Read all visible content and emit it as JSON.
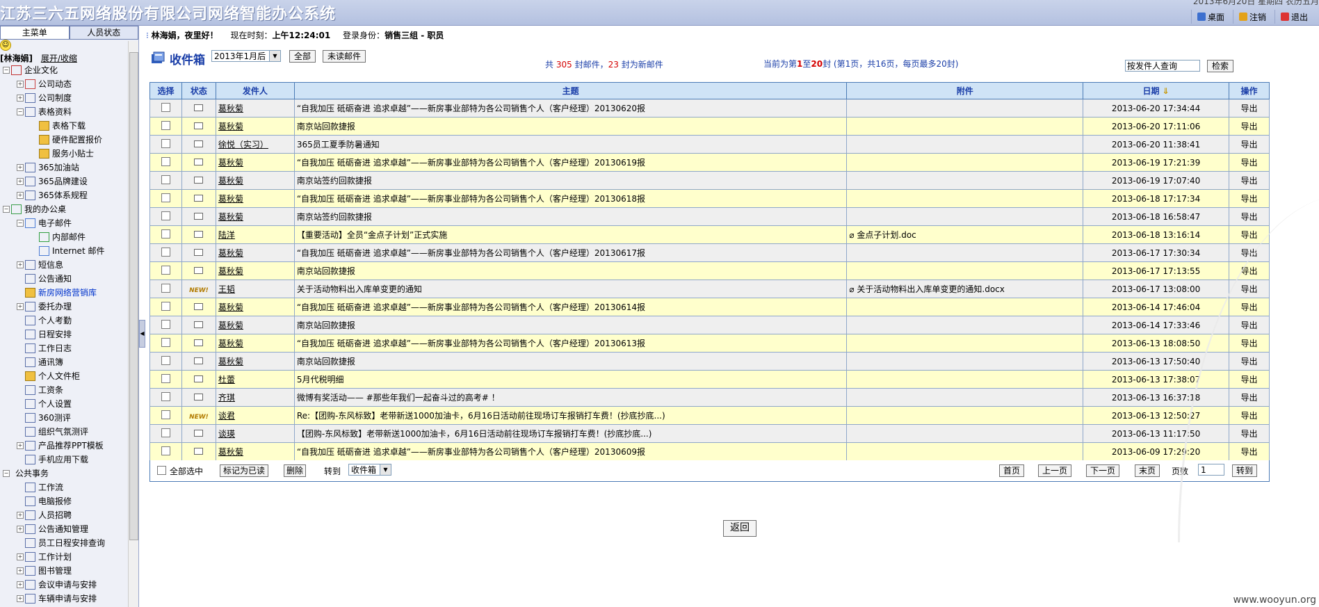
{
  "app": {
    "title": "江苏三六五网络股份有限公司网络智能办公系统",
    "date_partial": "2013年6月20日 星期四 农历五月",
    "buttons": {
      "desktop": "桌面",
      "logout": "注销",
      "exit": "退出"
    }
  },
  "left": {
    "tabs": {
      "main_menu": "主菜单",
      "people": "人员状态"
    },
    "user": "[林海娟]",
    "toggle": "展开/收缩",
    "tree": [
      {
        "label": "企业文化",
        "level": 0,
        "exp": "-",
        "icon": "culture-icon"
      },
      {
        "label": "公司动态",
        "level": 1,
        "exp": "+",
        "icon": "chart-icon"
      },
      {
        "label": "公司制度",
        "level": 1,
        "exp": "+",
        "icon": "document-icon"
      },
      {
        "label": "表格资料",
        "level": 1,
        "exp": "-",
        "icon": "search-doc-icon"
      },
      {
        "label": "表格下载",
        "level": 2,
        "exp": "",
        "icon": "folder-icon"
      },
      {
        "label": "硬件配置报价",
        "level": 2,
        "exp": "",
        "icon": "folder-icon"
      },
      {
        "label": "服务小贴士",
        "level": 2,
        "exp": "",
        "icon": "folder-icon"
      },
      {
        "label": "365加油站",
        "level": 1,
        "exp": "+",
        "icon": "station-icon"
      },
      {
        "label": "365品牌建设",
        "level": 1,
        "exp": "+",
        "icon": "window-icon"
      },
      {
        "label": "365体系规程",
        "level": 1,
        "exp": "+",
        "icon": "window-icon"
      },
      {
        "label": "我的办公桌",
        "level": 0,
        "exp": "-",
        "icon": "desk-icon"
      },
      {
        "label": "电子邮件",
        "level": 1,
        "exp": "-",
        "icon": "mail-icon"
      },
      {
        "label": "内部邮件",
        "level": 2,
        "exp": "",
        "icon": "inner-mail-icon"
      },
      {
        "label": "Internet 邮件",
        "level": 2,
        "exp": "",
        "icon": "internet-mail-icon"
      },
      {
        "label": "短信息",
        "level": 1,
        "exp": "+",
        "icon": "sms-icon"
      },
      {
        "label": "公告通知",
        "level": 1,
        "exp": "",
        "icon": "announce-icon"
      },
      {
        "label": "新房网络营销库",
        "level": 1,
        "exp": "",
        "icon": "folder-icon",
        "highlight": true
      },
      {
        "label": "委托办理",
        "level": 1,
        "exp": "+",
        "icon": "delegate-icon"
      },
      {
        "label": "个人考勤",
        "level": 1,
        "exp": "",
        "icon": "attendance-icon"
      },
      {
        "label": "日程安排",
        "level": 1,
        "exp": "",
        "icon": "calendar-icon"
      },
      {
        "label": "工作日志",
        "level": 1,
        "exp": "",
        "icon": "pencil-icon"
      },
      {
        "label": "通讯簿",
        "level": 1,
        "exp": "",
        "icon": "addressbook-icon"
      },
      {
        "label": "个人文件柜",
        "level": 1,
        "exp": "",
        "icon": "folder-icon"
      },
      {
        "label": "工资条",
        "level": 1,
        "exp": "",
        "icon": "salary-icon"
      },
      {
        "label": "个人设置",
        "level": 1,
        "exp": "",
        "icon": "settings-icon"
      },
      {
        "label": "360测评",
        "level": 1,
        "exp": "",
        "icon": "evaluation-icon"
      },
      {
        "label": "组织气氛测评",
        "level": 1,
        "exp": "",
        "icon": "evaluation-icon"
      },
      {
        "label": "产品推荐PPT模板",
        "level": 1,
        "exp": "+",
        "icon": "document-icon"
      },
      {
        "label": "手机应用下载",
        "level": 1,
        "exp": "",
        "icon": "download-icon"
      },
      {
        "label": "公共事务",
        "level": 0,
        "exp": "-",
        "icon": ""
      },
      {
        "label": "工作流",
        "level": 1,
        "exp": "",
        "icon": "workflow-icon"
      },
      {
        "label": "电脑报修",
        "level": 1,
        "exp": "",
        "icon": "repair-icon"
      },
      {
        "label": "人员招聘",
        "level": 1,
        "exp": "+",
        "icon": "recruit-icon"
      },
      {
        "label": "公告通知管理",
        "level": 1,
        "exp": "+",
        "icon": "announce-icon"
      },
      {
        "label": "员工日程安排查询",
        "level": 1,
        "exp": "",
        "icon": "document-icon"
      },
      {
        "label": "工作计划",
        "level": 1,
        "exp": "+",
        "icon": "plan-icon"
      },
      {
        "label": "图书管理",
        "level": 1,
        "exp": "+",
        "icon": "book-icon"
      },
      {
        "label": "会议申请与安排",
        "level": 1,
        "exp": "+",
        "icon": "meeting-icon"
      },
      {
        "label": "车辆申请与安排",
        "level": 1,
        "exp": "+",
        "icon": "car-icon"
      }
    ]
  },
  "status": {
    "greeting": "林海娟，夜里好！",
    "time_label": "现在时刻：",
    "time": "上午12:24:01",
    "role_label": "登录身份：",
    "role": "销售三组 - 职员"
  },
  "inbox": {
    "title": "收件箱",
    "period": "2013年1月后",
    "btn_all": "全部",
    "btn_unread": "未读邮件",
    "count_prefix": "共",
    "count_total": "305",
    "count_mid": "封邮件，",
    "count_new": "23",
    "count_suffix": "封为新邮件",
    "page_info_prefix": "当前为第",
    "page_from": "1",
    "page_to_label": "至",
    "page_to": "20",
    "page_info_suffix": "封 (第1页，共16页，每页最多20封)",
    "search_placeholder": "按发件人查询",
    "search_button": "检索"
  },
  "table": {
    "headers": [
      "选择",
      "状态",
      "发件人",
      "主题",
      "附件",
      "日期",
      "操作"
    ],
    "export_label": "导出",
    "rows": [
      {
        "status": "read",
        "sender": "葛秋菊",
        "subject": "“自我加压 砥砺奋进 追求卓越”——新房事业部特为各公司销售个人（客户经理）20130620报",
        "attachment": "",
        "date": "2013-06-20 17:34:44"
      },
      {
        "status": "read",
        "sender": "葛秋菊",
        "subject": "南京站回款捷报",
        "attachment": "",
        "date": "2013-06-20 17:11:06"
      },
      {
        "status": "read",
        "sender": "徐悦（实习）",
        "subject": "365员工夏季防暑通知",
        "attachment": "",
        "date": "2013-06-20 11:38:41"
      },
      {
        "status": "read",
        "sender": "葛秋菊",
        "subject": "“自我加压 砥砺奋进 追求卓越”——新房事业部特为各公司销售个人（客户经理）20130619报",
        "attachment": "",
        "date": "2013-06-19 17:21:39"
      },
      {
        "status": "read",
        "sender": "葛秋菊",
        "subject": "南京站签约回款捷报",
        "attachment": "",
        "date": "2013-06-19 17:07:40"
      },
      {
        "status": "read",
        "sender": "葛秋菊",
        "subject": "“自我加压 砥砺奋进 追求卓越”——新房事业部特为各公司销售个人（客户经理）20130618报",
        "attachment": "",
        "date": "2013-06-18 17:17:34"
      },
      {
        "status": "read",
        "sender": "葛秋菊",
        "subject": "南京站签约回款捷报",
        "attachment": "",
        "date": "2013-06-18 16:58:47"
      },
      {
        "status": "read",
        "sender": "陆洋",
        "subject": "【重要活动】全员“金点子计划”正式实施",
        "attachment": "金点子计划.doc",
        "date": "2013-06-18 13:16:14"
      },
      {
        "status": "read",
        "sender": "葛秋菊",
        "subject": "“自我加压 砥砺奋进 追求卓越”——新房事业部特为各公司销售个人（客户经理）20130617报",
        "attachment": "",
        "date": "2013-06-17 17:30:34"
      },
      {
        "status": "read",
        "sender": "葛秋菊",
        "subject": "南京站回款捷报",
        "attachment": "",
        "date": "2013-06-17 17:13:55"
      },
      {
        "status": "new",
        "sender": "王韬",
        "subject": "关于活动物料出入库单变更的通知",
        "attachment": "关于活动物料出入库单变更的通知.docx",
        "date": "2013-06-17 13:08:00"
      },
      {
        "status": "read",
        "sender": "葛秋菊",
        "subject": "“自我加压 砥砺奋进 追求卓越”——新房事业部特为各公司销售个人（客户经理）20130614报",
        "attachment": "",
        "date": "2013-06-14 17:46:04"
      },
      {
        "status": "read",
        "sender": "葛秋菊",
        "subject": "南京站回款捷报",
        "attachment": "",
        "date": "2013-06-14 17:33:46"
      },
      {
        "status": "read",
        "sender": "葛秋菊",
        "subject": "“自我加压 砥砺奋进 追求卓越”——新房事业部特为各公司销售个人（客户经理）20130613报",
        "attachment": "",
        "date": "2013-06-13 18:08:50"
      },
      {
        "status": "read",
        "sender": "葛秋菊",
        "subject": "南京站回款捷报",
        "attachment": "",
        "date": "2013-06-13 17:50:40"
      },
      {
        "status": "read",
        "sender": "杜蕾",
        "subject": "5月代税明细",
        "attachment": "",
        "date": "2013-06-13 17:38:07"
      },
      {
        "status": "read",
        "sender": "齐琪",
        "subject": "微博有奖活动—— #那些年我们一起奋斗过的高考# ！",
        "attachment": "",
        "date": "2013-06-13 16:37:18"
      },
      {
        "status": "new",
        "sender": "谈君",
        "subject": "Re:【团购-东风标致】老带新送1000加油卡，6月16日活动前往现场订车报销打车费！(抄底抄底...)",
        "attachment": "",
        "date": "2013-06-13 12:50:27"
      },
      {
        "status": "read",
        "sender": "谈瑛",
        "subject": "【团购-东风标致】老带新送1000加油卡，6月16日活动前往现场订车报销打车费！(抄底抄底...)",
        "attachment": "",
        "date": "2013-06-13 11:17:50"
      },
      {
        "status": "read",
        "sender": "葛秋菊",
        "subject": "“自我加压 砥砺奋进 追求卓越”——新房事业部特为各公司销售个人（客户经理）20130609报",
        "attachment": "",
        "date": "2013-06-09 17:29:20"
      }
    ]
  },
  "footer": {
    "select_all": "全部选中",
    "mark_read": "标记为已读",
    "delete": "删除",
    "move_to": "转到",
    "folder": "收件箱",
    "first": "首页",
    "prev": "上一页",
    "next": "下一页",
    "last": "末页",
    "page_label": "页数",
    "page_value": "1",
    "go": "转到"
  },
  "return_button": "返回",
  "watermark": "www.wooyun.org"
}
